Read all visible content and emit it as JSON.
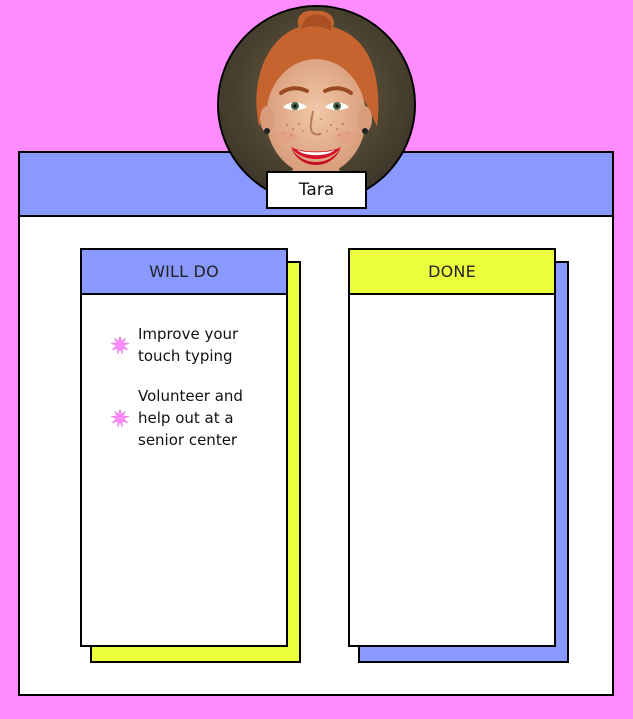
{
  "profile": {
    "name": "Tara",
    "photo": "avatar-photo-icon"
  },
  "columns": {
    "will_do": {
      "title": "WILL DO",
      "header_color": "#8999ff",
      "shadow_color": "#ebff3d",
      "items": [
        {
          "text": "Improve your touch typing",
          "icon": "starburst-bullet-icon"
        },
        {
          "text": "Volunteer and help out at a senior center",
          "icon": "starburst-bullet-icon"
        }
      ]
    },
    "done": {
      "title": "DONE",
      "header_color": "#ebff3d",
      "shadow_color": "#8999ff",
      "items": []
    }
  },
  "colors": {
    "background": "#ff8cff",
    "bullet": "#ff8cff",
    "board_header": "#8999ff"
  }
}
